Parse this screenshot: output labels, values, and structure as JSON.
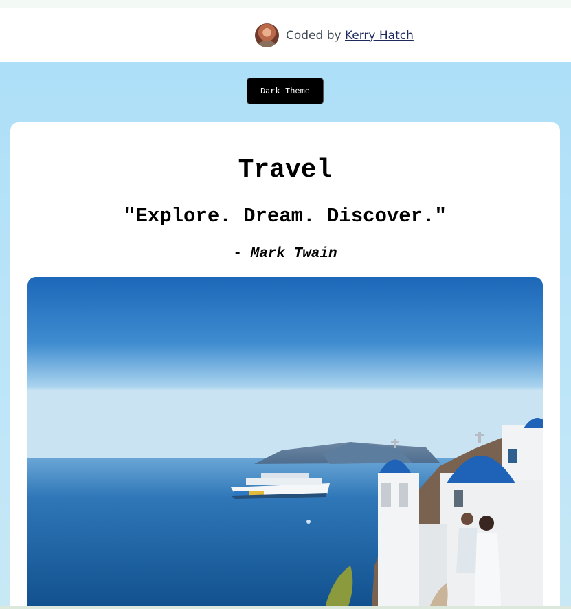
{
  "credit": {
    "prefix": "Coded by",
    "author_link": "Kerry Hatch"
  },
  "theme_toggle": {
    "label": "Dark Theme"
  },
  "card": {
    "title": "Travel",
    "quote": "\"Explore. Dream. Discover.\"",
    "author_dash": "- ",
    "author": "Mark Twain",
    "photo_alt": "Santorini coastline with a cruise ship and a couple overlooking the sea"
  },
  "colors": {
    "page_background": "#addff8",
    "card_background": "#ffffff",
    "button_background": "#000000",
    "link_color": "#1f2a5c",
    "sky_top": "#1d67b8",
    "sea": "#1d5f9f",
    "dome_blue": "#1e63b8"
  }
}
